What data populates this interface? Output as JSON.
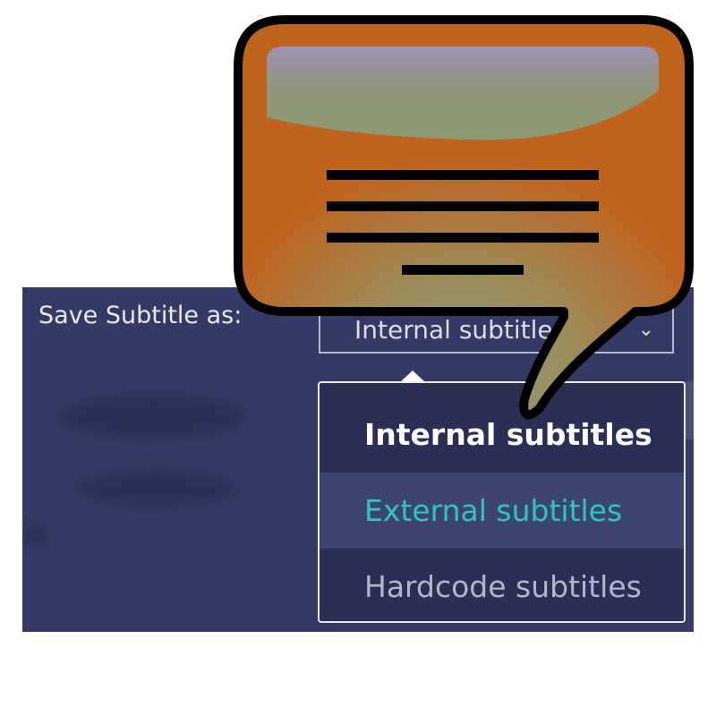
{
  "save_subtitle": {
    "label": "Save Subtitle as:",
    "selected_value": "Internal subtitles",
    "arrow_glyph": "⌄"
  },
  "dropdown": {
    "options": [
      {
        "label": "Internal subtitles",
        "state": "selected"
      },
      {
        "label": "External subtitles",
        "state": "hovered"
      },
      {
        "label": "Hardcode subtitles",
        "state": "normal"
      }
    ]
  },
  "overlay": {
    "icon": "speech-bubble-icon",
    "colors": {
      "bubble_fill": "#c0631f",
      "bubble_glow": "#8aa080",
      "outline": "#000000"
    }
  },
  "colors": {
    "panel_bg": "#343a65",
    "dropdown_bg": "#2b2f56",
    "hover_bg": "#3e4472",
    "accent_teal": "#2fc4c1"
  }
}
